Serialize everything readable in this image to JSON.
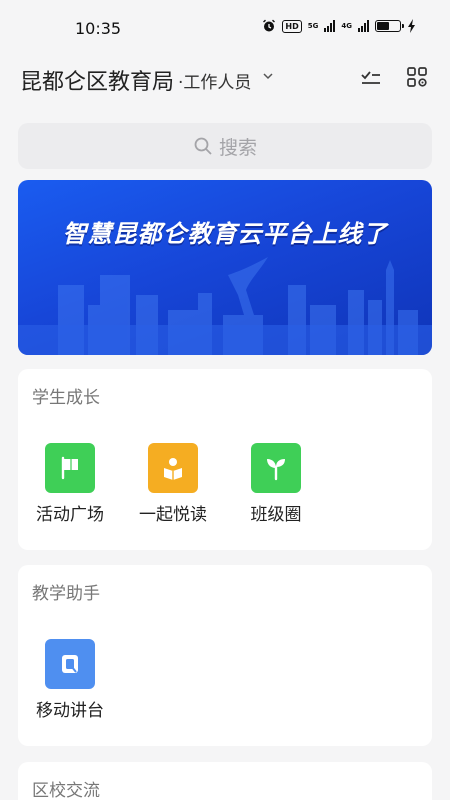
{
  "status_bar": {
    "time": "10:35",
    "hd_badge": "HD",
    "network_1": "5G",
    "network_2": "4G"
  },
  "header": {
    "title": "昆都仑区教育局",
    "role": "·工作人员"
  },
  "search": {
    "placeholder": "搜索"
  },
  "banner": {
    "text": "智慧昆都仑教育云平台上线了"
  },
  "sections": [
    {
      "title": "学生成长",
      "apps": [
        {
          "label": "活动广场",
          "icon": "flag-icon",
          "color": "#3fcf57"
        },
        {
          "label": "一起悦读",
          "icon": "reading-icon",
          "color": "#f5ad22"
        },
        {
          "label": "班级圈",
          "icon": "sprout-icon",
          "color": "#3fcf57"
        }
      ]
    },
    {
      "title": "教学助手",
      "apps": [
        {
          "label": "移动讲台",
          "icon": "podium-icon",
          "color": "#4f8ff0"
        }
      ]
    },
    {
      "title": "区校交流",
      "apps": []
    }
  ]
}
